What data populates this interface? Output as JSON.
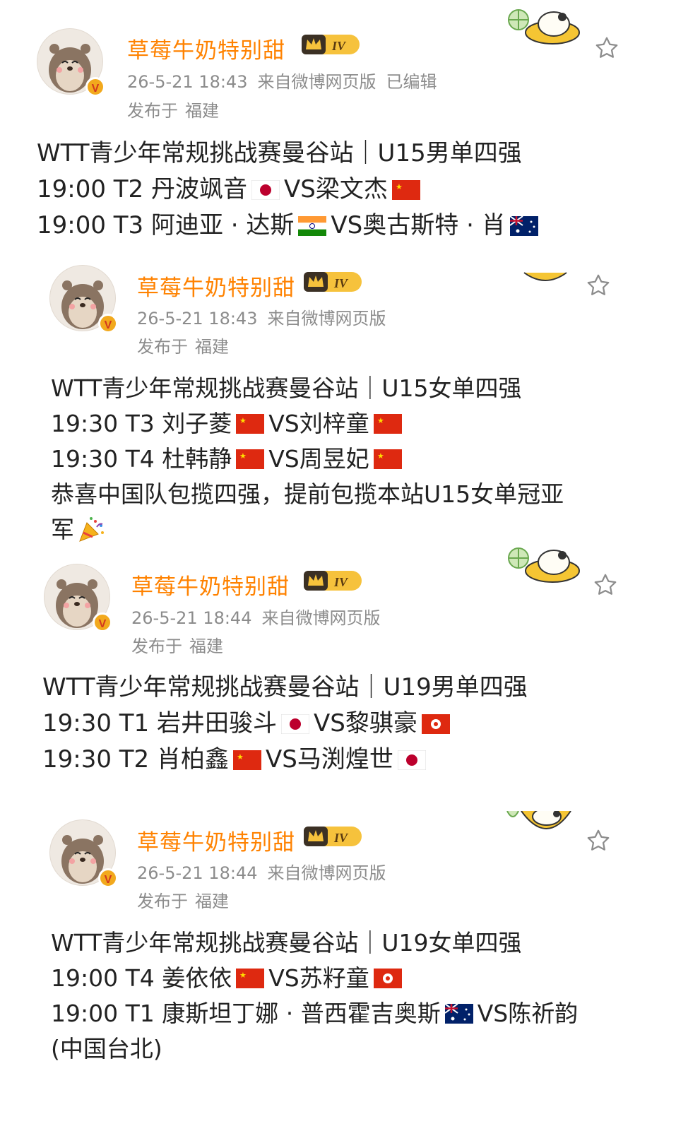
{
  "posts": [
    {
      "username": "草莓牛奶特别甜",
      "level": "IV",
      "date": "26-5-21 18:43",
      "source": "来自微博网页版",
      "edited": "已编辑",
      "location_label": "发布于",
      "location": "福建",
      "lines": [
        {
          "text": "WTT青少年常规挑战赛曼谷站｜U15男单四强"
        },
        {
          "a": "19:00 T2 丹波飒音",
          "fa": "jp",
          "vs": "VS",
          "b": "梁文杰",
          "fb": "cn"
        },
        {
          "a": "19:00 T3 阿迪亚 · 达斯",
          "fa": "in",
          "vs": "VS",
          "b": "奥古斯特 · 肖",
          "fb": "au"
        }
      ]
    },
    {
      "username": "草莓牛奶特别甜",
      "level": "IV",
      "date": "26-5-21 18:43",
      "source": "来自微博网页版",
      "location_label": "发布于",
      "location": "福建",
      "lines": [
        {
          "text": "WTT青少年常规挑战赛曼谷站｜U15女单四强"
        },
        {
          "a": "19:30 T3 刘子菱",
          "fa": "cn",
          "vs": "VS",
          "b": "刘梓童",
          "fb": "cn"
        },
        {
          "a": "19:30 T4 杜韩静",
          "fa": "cn",
          "vs": "VS",
          "b": "周昱妃",
          "fb": "cn"
        },
        {
          "text": "恭喜中国队包揽四强，提前包揽本站U15女单冠亚"
        },
        {
          "text": "军",
          "emoji": "party-popper"
        }
      ]
    },
    {
      "username": "草莓牛奶特别甜",
      "level": "IV",
      "date": "26-5-21 18:44",
      "source": "来自微博网页版",
      "location_label": "发布于",
      "location": "福建",
      "lines": [
        {
          "text": "WTT青少年常规挑战赛曼谷站｜U19男单四强"
        },
        {
          "a": "19:30 T1 岩井田骏斗",
          "fa": "jp",
          "vs": "VS",
          "b": "黎骐豪",
          "fb": "hk"
        },
        {
          "a": "19:30 T2 肖柏鑫",
          "fa": "cn",
          "vs": "VS",
          "b": "马渕煌世",
          "fb": "jp"
        }
      ]
    },
    {
      "username": "草莓牛奶特别甜",
      "level": "IV",
      "date": "26-5-21 18:44",
      "source": "来自微博网页版",
      "location_label": "发布于",
      "location": "福建",
      "lines": [
        {
          "text": "WTT青少年常规挑战赛曼谷站｜U19女单四强"
        },
        {
          "a": "19:00 T4 姜依依",
          "fa": "cn",
          "vs": "VS",
          "b": "苏籽童",
          "fb": "hk"
        },
        {
          "a": "19:00 T1 康斯坦丁娜 · 普西霍吉奥斯",
          "fa": "au",
          "vs": "VS",
          "b": "陈祈韵"
        },
        {
          "text": "(中国台北)"
        }
      ]
    }
  ],
  "icons": {
    "favorite": "star-outline-icon",
    "verified": "verified-v-badge",
    "level": "crown-level-badge"
  },
  "colors": {
    "username": "#ff8200",
    "meta": "#8c8c8c",
    "text": "#222222"
  }
}
